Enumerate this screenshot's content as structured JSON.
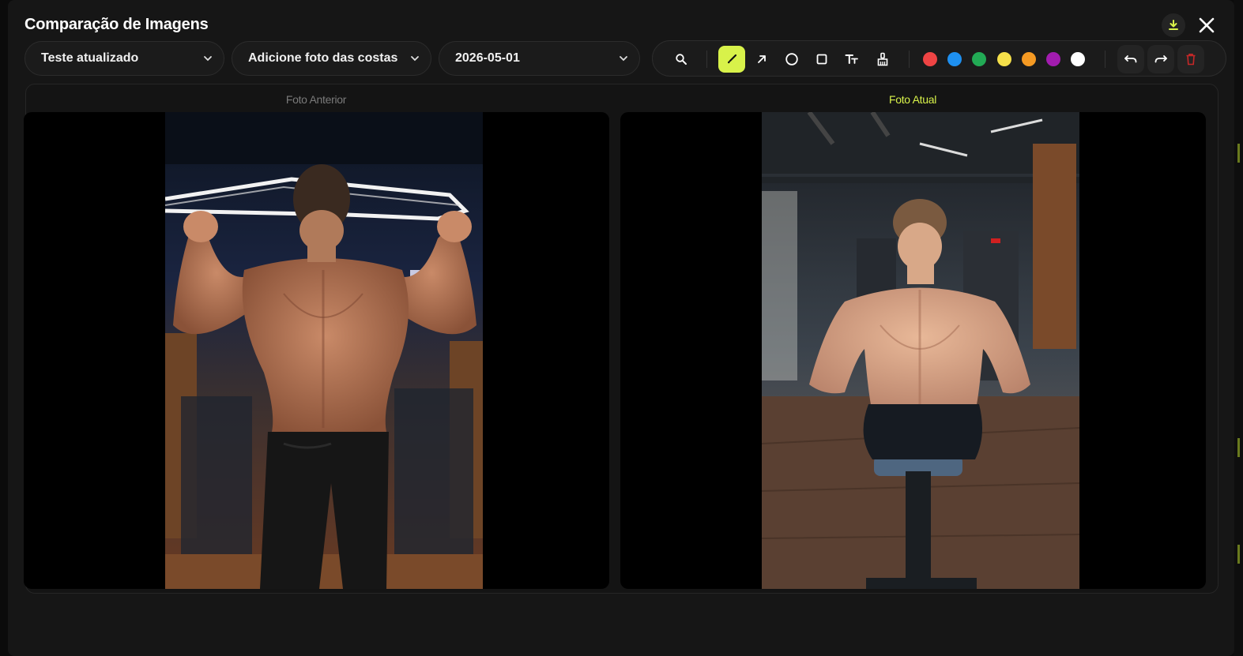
{
  "modal": {
    "title": "Comparação de Imagens"
  },
  "filters": {
    "routine": "Teste atualizado",
    "pose": "Adicione foto das costas ...",
    "date": "2026-05-01"
  },
  "toolbar": {
    "tools": [
      "zoom-icon",
      "brush-icon",
      "arrow-icon",
      "circle-icon",
      "square-icon",
      "text-icon",
      "eraser-icon"
    ],
    "active_tool": "brush-icon",
    "colors": [
      "#ef4444",
      "#1e90f0",
      "#22aa55",
      "#f5e04a",
      "#f59a23",
      "#a21caf",
      "#ffffff"
    ],
    "accent": "#d8f24a"
  },
  "comparison": {
    "previous_label": "Foto Anterior",
    "current_label": "Foto Atual"
  }
}
